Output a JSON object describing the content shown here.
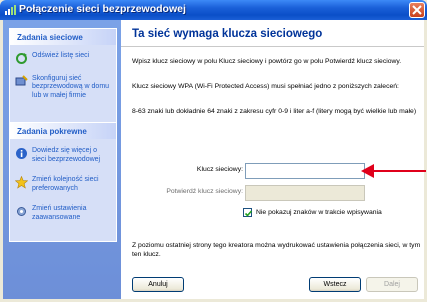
{
  "window": {
    "title": "Połączenie sieci bezprzewodowej"
  },
  "sidebar": {
    "network_tasks": {
      "header": "Zadania sieciowe",
      "items": [
        {
          "label": "Odśwież listę sieci",
          "icon": "refresh-icon"
        },
        {
          "label": "Skonfiguruj sieć bezprzewodową w domu lub w małej firmie",
          "icon": "wizard-network-icon"
        }
      ]
    },
    "related_tasks": {
      "header": "Zadania pokrewne",
      "items": [
        {
          "label": "Dowiedz się więcej o sieci bezprzewodowej",
          "icon": "info-icon"
        },
        {
          "label": "Zmień kolejność sieci preferowanych",
          "icon": "star-icon"
        },
        {
          "label": "Zmień ustawienia zaawansowane",
          "icon": "settings-icon"
        }
      ]
    }
  },
  "main": {
    "heading": "Ta sieć wymaga klucza sieciowego",
    "intro": "Wpisz klucz sieciowy w polu Klucz sieciowy i powtórz go w polu Potwierdź klucz sieciowy.",
    "requirement": "Klucz sieciowy WPA (Wi-Fi Protected Access) musi spełniać jedno z poniższych zaleceń:",
    "rule": "8-63 znaki lub dokładnie 64 znaki z zakresu cyfr 0-9 i liter a-f (litery mogą być wielkie lub małe)",
    "key_label": "Klucz sieciowy:",
    "key_value": "",
    "confirm_label": "Potwierdź klucz sieciowy:",
    "confirm_value": "",
    "hide_chars_label": "Nie pokazuj znaków w trakcie wpisywania",
    "hide_chars_checked": true,
    "footer_note": "Z poziomu ostatniej strony tego kreatora można wydrukować ustawienia połączenia sieci, w tym ten klucz."
  },
  "buttons": {
    "cancel": "Anuluj",
    "back": "Wstecz",
    "next": "Dalej"
  },
  "colors": {
    "annotation_arrow": "#e0001b",
    "heading": "#003399",
    "link": "#215dc6"
  }
}
